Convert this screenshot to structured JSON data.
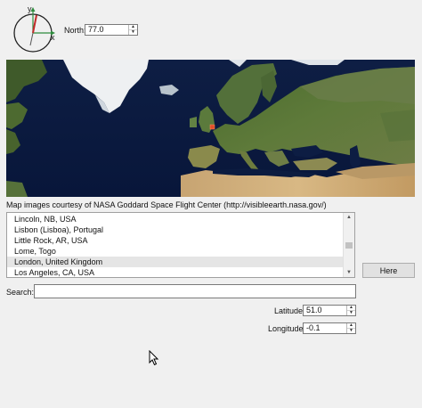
{
  "compass": {
    "y_label": "y",
    "x_label": "x",
    "axis_color": "#2e8b3d",
    "needle_color": "#c22a2a"
  },
  "north": {
    "label": "North:",
    "value": "77.0"
  },
  "map": {
    "caption": "Map images courtesy of NASA Goddard Space Flight Center (http://visibleearth.nasa.gov/)",
    "marker_color": "#e0502a"
  },
  "locations": {
    "items": [
      "Lincoln, NB, USA",
      "Lisbon (Lisboa), Portugal",
      "Little Rock, AR, USA",
      "Lome, Togo",
      "London, United Kingdom",
      "Los Angeles, CA, USA"
    ],
    "selected_index": 4
  },
  "here_button": {
    "label": "Here"
  },
  "search": {
    "label": "Search:",
    "value": ""
  },
  "latitude": {
    "label": "Latitude:",
    "value": "51.0"
  },
  "longitude": {
    "label": "Longitude:",
    "value": "-0.1"
  }
}
